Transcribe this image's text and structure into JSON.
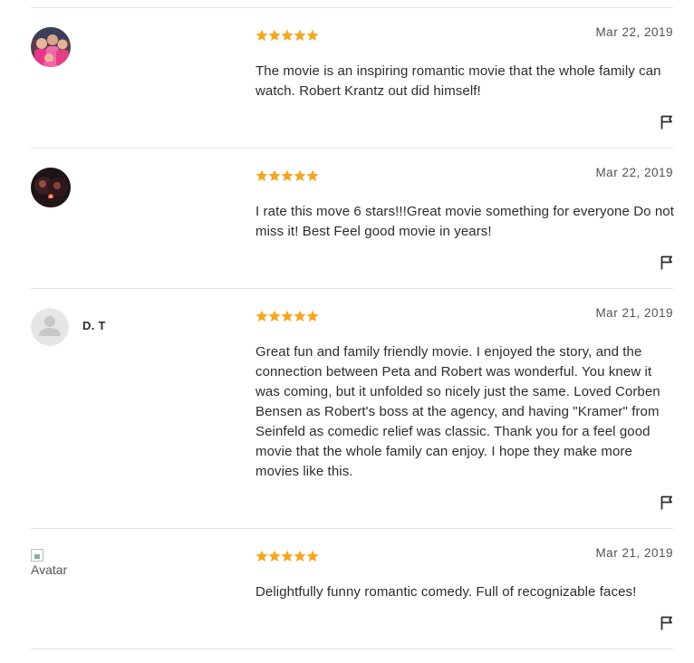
{
  "reviews": [
    {
      "username": "",
      "avatar": "photo-group",
      "rating": 5,
      "date": "Mar 22, 2019",
      "text": "The movie is an inspiring romantic movie that the whole family can watch. Robert Krantz out did himself!"
    },
    {
      "username": "",
      "avatar": "photo-dark",
      "rating": 5,
      "date": "Mar 22, 2019",
      "text": "I rate this move 6 stars!!!Great movie something for everyone Do not miss it! Best Feel good movie in years!"
    },
    {
      "username": "D. T",
      "avatar": "default-user-icon",
      "rating": 5,
      "date": "Mar 21, 2019",
      "text": "Great fun and family friendly movie. I enjoyed the story, and the connection between Peta and Robert was wonderful. You knew it was coming, but it unfolded so nicely just the same. Loved Corben Bensen as Robert's boss at the agency, and having \"Kramer\" from Seinfeld as comedic relief was classic. Thank you for a feel good movie that the whole family can enjoy. I hope they make more movies like this."
    },
    {
      "username": "",
      "avatar_alt": "Avatar",
      "rating": 5,
      "date": "Mar 21, 2019",
      "text": "Delightfully funny romantic comedy. Full of recognizable faces!"
    }
  ],
  "colors": {
    "star": "#f5a623",
    "divider": "#e3e3e3",
    "text": "#2a2c32",
    "date": "#505257"
  },
  "icons": {
    "star": "star-icon",
    "flag": "flag-icon",
    "default_avatar": "user-icon"
  }
}
